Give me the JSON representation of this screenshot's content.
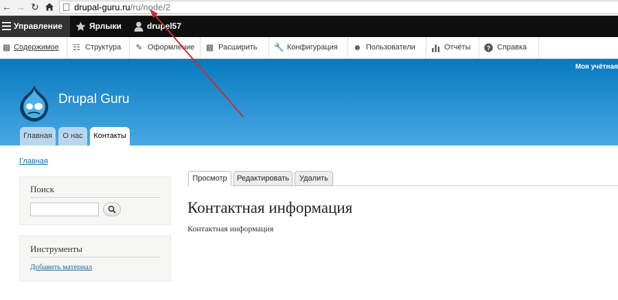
{
  "browser": {
    "url_host": "drupal-guru.ru",
    "url_path": "/ru/node/2"
  },
  "toolbar": {
    "manage": "Управление",
    "shortcuts": "Ярлыки",
    "user": "drupel57"
  },
  "tray": {
    "items": [
      {
        "label": "Содержимое",
        "icon": "content-icon"
      },
      {
        "label": "Структура",
        "icon": "structure-icon"
      },
      {
        "label": "Оформление",
        "icon": "appearance-icon"
      },
      {
        "label": "Расширить",
        "icon": "extend-icon"
      },
      {
        "label": "Конфигурация",
        "icon": "wrench-icon"
      },
      {
        "label": "Пользователи",
        "icon": "people-icon"
      },
      {
        "label": "Отчёты",
        "icon": "reports-icon"
      },
      {
        "label": "Справка",
        "icon": "help-icon"
      }
    ]
  },
  "header": {
    "secondary_menu": "Моя учётная",
    "site_name": "Drupal Guru",
    "tabs": [
      "Главная",
      "О нас",
      "Контакты"
    ]
  },
  "breadcrumb": "Главная",
  "sidebar": {
    "search_title": "Поиск",
    "tools_title": "Инструменты",
    "tools_link": "Добавить материал"
  },
  "content": {
    "tabs": [
      "Просмотр",
      "Редактировать",
      "Удалить"
    ],
    "title": "Контактная информация",
    "body": "Контактная информация"
  },
  "colors": {
    "header_top": "#0779bf",
    "header_bottom": "#48a9e4",
    "toolbar": "#0f0f0f",
    "annotation_arrow": "#d42a2a"
  }
}
